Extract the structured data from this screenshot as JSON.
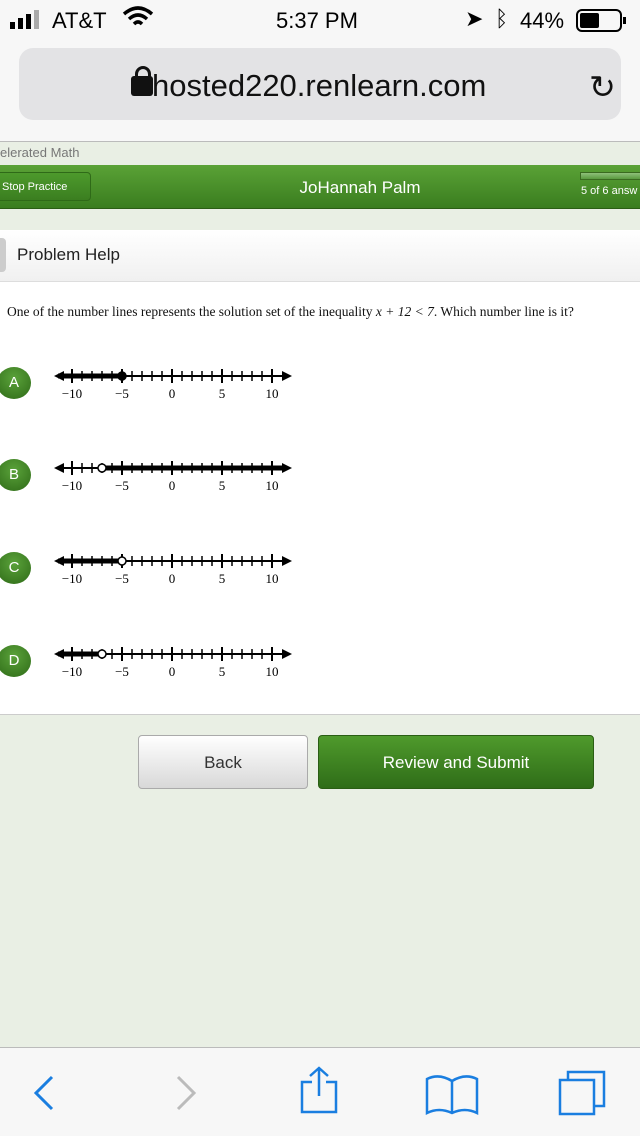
{
  "status": {
    "carrier": "AT&T",
    "time": "5:37 PM",
    "battery": "44%"
  },
  "browser": {
    "url": "hosted220.renlearn.com"
  },
  "app": {
    "name": "elerated Math",
    "stop_label": "Stop Practice",
    "student": "JoHannah Palm",
    "progress_text": "5 of 6 answ",
    "progress_fraction": 0.83
  },
  "help": {
    "title": "Problem Help"
  },
  "question": {
    "pre": "One of the number lines represents the solution set of the inequality ",
    "math": "x + 12 < 7",
    "post": ". Which number line is it?"
  },
  "number_line": {
    "min": -10,
    "max": 10,
    "labels": [
      "−10",
      "−5",
      "0",
      "5",
      "10"
    ],
    "label_values": [
      -10,
      -5,
      0,
      5,
      10
    ]
  },
  "options": [
    {
      "letter": "A",
      "point": -5,
      "closed": true,
      "direction": "left"
    },
    {
      "letter": "B",
      "point": -7,
      "closed": false,
      "direction": "right"
    },
    {
      "letter": "C",
      "point": -5,
      "closed": false,
      "direction": "left"
    },
    {
      "letter": "D",
      "point": -7,
      "closed": false,
      "direction": "left"
    }
  ],
  "buttons": {
    "back": "Back",
    "submit": "Review and Submit"
  },
  "colors": {
    "green": "#3f8a22",
    "ios_blue": "#1a7ee0"
  }
}
